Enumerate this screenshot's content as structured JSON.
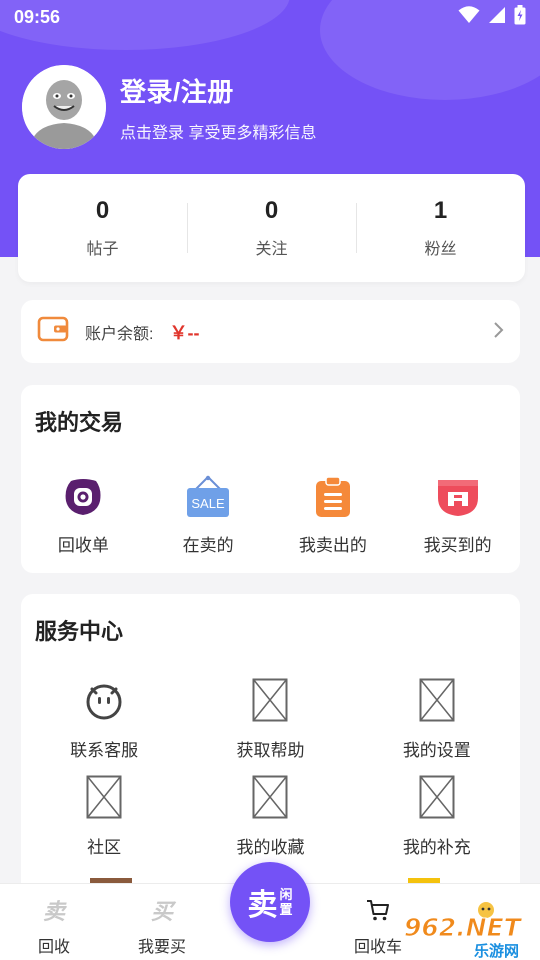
{
  "status_bar": {
    "time": "09:56"
  },
  "profile": {
    "title": "登录/注册",
    "subtitle": "点击登录 享受更多精彩信息"
  },
  "stats": [
    {
      "value": "0",
      "label": "帖子"
    },
    {
      "value": "0",
      "label": "关注"
    },
    {
      "value": "1",
      "label": "粉丝"
    }
  ],
  "balance": {
    "label": "账户余额:",
    "value": "￥--"
  },
  "trade": {
    "title": "我的交易",
    "items": [
      {
        "label": "回收单",
        "icon": "recycle-order-icon"
      },
      {
        "label": "在卖的",
        "icon": "sale-sign-icon",
        "icon_text": "SALE"
      },
      {
        "label": "我卖出的",
        "icon": "clipboard-icon"
      },
      {
        "label": "我买到的",
        "icon": "purchased-bag-icon"
      }
    ]
  },
  "service": {
    "title": "服务中心",
    "items": [
      {
        "label": "联系客服",
        "icon": "robot-face-icon"
      },
      {
        "label": "获取帮助",
        "icon": "image-placeholder-icon"
      },
      {
        "label": "我的设置",
        "icon": "image-placeholder-icon"
      },
      {
        "label": "社区",
        "icon": "image-placeholder-icon"
      },
      {
        "label": "我的收藏",
        "icon": "image-placeholder-icon"
      },
      {
        "label": "我的补充",
        "icon": "image-placeholder-icon"
      }
    ]
  },
  "nav": {
    "items": [
      {
        "label": "回收",
        "icon": "sell-char-icon",
        "glyph": "卖"
      },
      {
        "label": "我要买",
        "icon": "buy-char-icon",
        "glyph": "买"
      },
      {
        "label": "回收车",
        "icon": "cart-icon"
      }
    ],
    "sell_button": {
      "main": "卖",
      "sub1": "闲",
      "sub2": "置"
    }
  },
  "watermark": {
    "text": "962.NET",
    "subtext": "乐游网"
  },
  "colors": {
    "primary": "#7452f6",
    "price": "#e0352c",
    "balance_icon": "#f08a3c"
  }
}
